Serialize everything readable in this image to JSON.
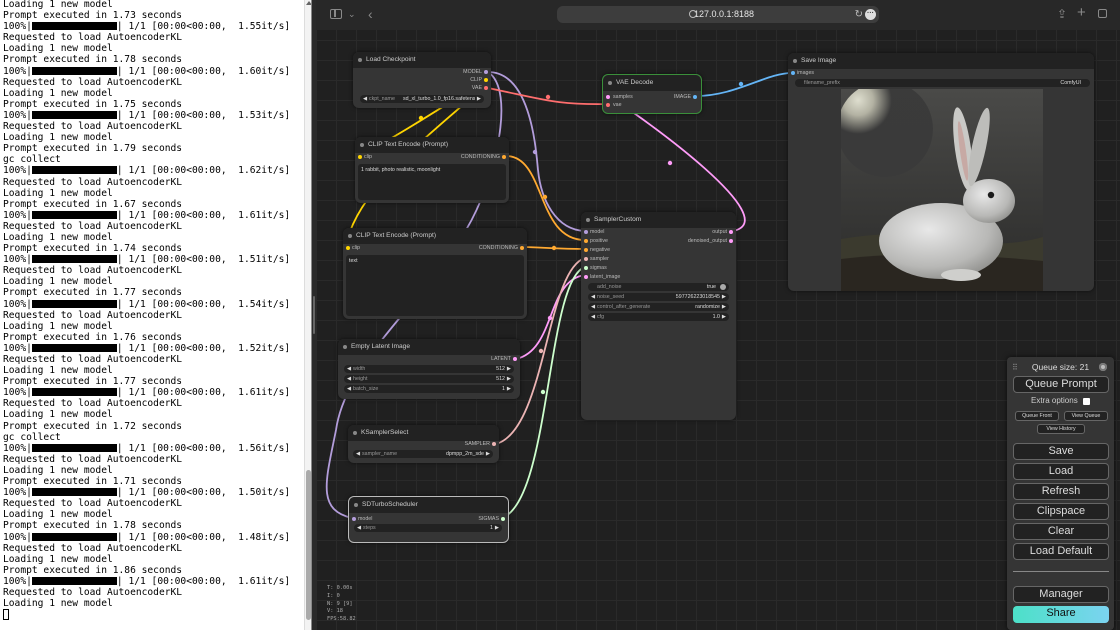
{
  "terminal": {
    "lines": [
      {
        "text": "Loading 1 new model"
      },
      {
        "text": "Prompt executed in 1.73 seconds"
      },
      {
        "pre": "100%|",
        "post": "| 1/1 [00:00<00:00,  1.55it/s]",
        "bar": true
      },
      {
        "text": "Requested to load AutoencoderKL"
      },
      {
        "text": "Loading 1 new model"
      },
      {
        "text": "Prompt executed in 1.78 seconds"
      },
      {
        "pre": "100%|",
        "post": "| 1/1 [00:00<00:00,  1.60it/s]",
        "bar": true
      },
      {
        "text": "Requested to load AutoencoderKL"
      },
      {
        "text": "Loading 1 new model"
      },
      {
        "text": "Prompt executed in 1.75 seconds"
      },
      {
        "pre": "100%|",
        "post": "| 1/1 [00:00<00:00,  1.53it/s]",
        "bar": true
      },
      {
        "text": "Requested to load AutoencoderKL"
      },
      {
        "text": "Loading 1 new model"
      },
      {
        "text": "Prompt executed in 1.79 seconds"
      },
      {
        "text": "gc collect"
      },
      {
        "pre": "100%|",
        "post": "| 1/1 [00:00<00:00,  1.62it/s]",
        "bar": true
      },
      {
        "text": "Requested to load AutoencoderKL"
      },
      {
        "text": "Loading 1 new model"
      },
      {
        "text": "Prompt executed in 1.67 seconds"
      },
      {
        "pre": "100%|",
        "post": "| 1/1 [00:00<00:00,  1.61it/s]",
        "bar": true
      },
      {
        "text": "Requested to load AutoencoderKL"
      },
      {
        "text": "Loading 1 new model"
      },
      {
        "text": "Prompt executed in 1.74 seconds"
      },
      {
        "pre": "100%|",
        "post": "| 1/1 [00:00<00:00,  1.51it/s]",
        "bar": true
      },
      {
        "text": "Requested to load AutoencoderKL"
      },
      {
        "text": "Loading 1 new model"
      },
      {
        "text": "Prompt executed in 1.77 seconds"
      },
      {
        "pre": "100%|",
        "post": "| 1/1 [00:00<00:00,  1.54it/s]",
        "bar": true
      },
      {
        "text": "Requested to load AutoencoderKL"
      },
      {
        "text": "Loading 1 new model"
      },
      {
        "text": "Prompt executed in 1.76 seconds"
      },
      {
        "pre": "100%|",
        "post": "| 1/1 [00:00<00:00,  1.52it/s]",
        "bar": true
      },
      {
        "text": "Requested to load AutoencoderKL"
      },
      {
        "text": "Loading 1 new model"
      },
      {
        "text": "Prompt executed in 1.77 seconds"
      },
      {
        "pre": "100%|",
        "post": "| 1/1 [00:00<00:00,  1.61it/s]",
        "bar": true
      },
      {
        "text": "Requested to load AutoencoderKL"
      },
      {
        "text": "Loading 1 new model"
      },
      {
        "text": "Prompt executed in 1.72 seconds"
      },
      {
        "text": "gc collect"
      },
      {
        "pre": "100%|",
        "post": "| 1/1 [00:00<00:00,  1.56it/s]",
        "bar": true
      },
      {
        "text": "Requested to load AutoencoderKL"
      },
      {
        "text": "Loading 1 new model"
      },
      {
        "text": "Prompt executed in 1.71 seconds"
      },
      {
        "pre": "100%|",
        "post": "| 1/1 [00:00<00:00,  1.50it/s]",
        "bar": true
      },
      {
        "text": "Requested to load AutoencoderKL"
      },
      {
        "text": "Loading 1 new model"
      },
      {
        "text": "Prompt executed in 1.78 seconds"
      },
      {
        "pre": "100%|",
        "post": "| 1/1 [00:00<00:00,  1.48it/s]",
        "bar": true
      },
      {
        "text": "Requested to load AutoencoderKL"
      },
      {
        "text": "Loading 1 new model"
      },
      {
        "text": "Prompt executed in 1.86 seconds"
      },
      {
        "pre": "100%|",
        "post": "| 1/1 [00:00<00:00,  1.61it/s]",
        "bar": true
      },
      {
        "text": "Requested to load AutoencoderKL"
      },
      {
        "text": "Loading 1 new model"
      }
    ]
  },
  "browser": {
    "url": "127.0.0.1:8188"
  },
  "nodes": {
    "load_checkpoint": {
      "title": "Load Checkpoint",
      "outputs": [
        "MODEL",
        "CLIP",
        "VAE"
      ],
      "ckpt_label": "ckpt_name",
      "ckpt_value": "sd_xl_turbo_1.0_fp16.safetensors"
    },
    "clip_pos": {
      "title": "CLIP Text Encode (Prompt)",
      "input": "clip",
      "output": "CONDITIONING",
      "text": "1 rabbit, photo realistic, moonlight"
    },
    "clip_neg": {
      "title": "CLIP Text Encode (Prompt)",
      "input": "clip",
      "output": "CONDITIONING",
      "text": "text"
    },
    "vae_decode": {
      "title": "VAE Decode",
      "inputs": [
        "samples",
        "vae"
      ],
      "output": "IMAGE"
    },
    "save_image": {
      "title": "Save Image",
      "input": "images",
      "prefix_label": "filename_prefix",
      "prefix_value": "ComfyUI"
    },
    "sampler_custom": {
      "title": "SamplerCustom",
      "inputs": [
        "model",
        "positive",
        "negative",
        "sampler",
        "sigmas",
        "latent_image"
      ],
      "outputs": [
        "output",
        "denoised_output"
      ],
      "widgets": [
        {
          "label": "add_noise",
          "value": "true"
        },
        {
          "label": "noise_seed",
          "value": "597726223018545"
        },
        {
          "label": "control_after_generate",
          "value": "randomize"
        },
        {
          "label": "cfg",
          "value": "1.0"
        }
      ]
    },
    "empty_latent": {
      "title": "Empty Latent Image",
      "output": "LATENT",
      "widgets": [
        {
          "label": "width",
          "value": "512"
        },
        {
          "label": "height",
          "value": "512"
        },
        {
          "label": "batch_size",
          "value": "1"
        }
      ]
    },
    "ksampler_select": {
      "title": "KSamplerSelect",
      "output": "SAMPLER",
      "sampler_label": "sampler_name",
      "sampler_value": "dpmpp_2m_sde"
    },
    "sd_turbo": {
      "title": "SDTurboScheduler",
      "input": "model",
      "output": "SIGMAS",
      "steps_label": "steps",
      "steps_value": "1"
    }
  },
  "queue_panel": {
    "queue_size": "Queue size: 21",
    "queue_prompt": "Queue Prompt",
    "extra_options": "Extra options",
    "queue_front": "Queue Front",
    "view_queue": "View Queue",
    "view_history": "View History",
    "save": "Save",
    "load": "Load",
    "refresh": "Refresh",
    "clipspace": "Clipspace",
    "clear": "Clear",
    "load_default": "Load Default",
    "manager": "Manager",
    "share": "Share"
  },
  "canvas_info": "T: 0.00s\nI: 0\nN: 9 [9]\nV: 18\nFPS:58.82",
  "colors": {
    "model": "#b39ddb",
    "clip": "#ffd500",
    "vae": "#ff6e6e",
    "conditioning": "#ffa931",
    "latent": "#ff9cf9",
    "image": "#64b5f6",
    "sampler": "#ecb4b4",
    "sigmas": "#cdffcd"
  }
}
